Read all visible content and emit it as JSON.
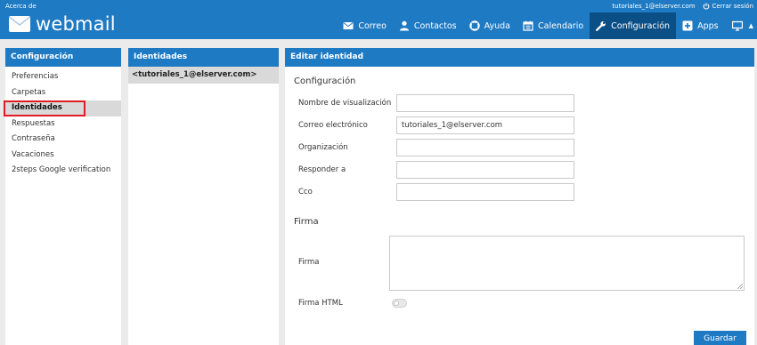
{
  "topbar": {
    "about_label": "Acerca de",
    "user_email": "tutoriales_1@elserver.com",
    "logout_label": "Cerrar sesión",
    "logo_text": "webmail"
  },
  "nav": {
    "mail": "Correo",
    "contacts": "Contactos",
    "help": "Ayuda",
    "calendar": "Calendario",
    "settings": "Configuración",
    "apps": "Apps"
  },
  "settings_panel": {
    "title": "Configuración",
    "items": [
      "Preferencias",
      "Carpetas",
      "Identidades",
      "Respuestas",
      "Contraseña",
      "Vacaciones",
      "2steps Google verification"
    ]
  },
  "identities_panel": {
    "title": "Identidades",
    "identity": "<tutoriales_1@elserver.com>"
  },
  "edit_panel": {
    "title": "Editar identidad",
    "section_config": "Configuración",
    "display_name_label": "Nombre de visualización",
    "display_name_value": "",
    "email_label": "Correo electrónico",
    "email_value": "tutoriales_1@elserver.com",
    "organization_label": "Organización",
    "organization_value": "",
    "reply_to_label": "Responder a",
    "reply_to_value": "",
    "bcc_label": "Cco",
    "bcc_value": "",
    "section_signature": "Firma",
    "signature_label": "Firma",
    "html_signature_label": "Firma HTML",
    "html_signature_enabled": false,
    "save_label": "Guardar"
  },
  "colors": {
    "accent": "#1f7ac4",
    "nav_active": "#0b4f87",
    "selection_outline": "#e01b24"
  }
}
